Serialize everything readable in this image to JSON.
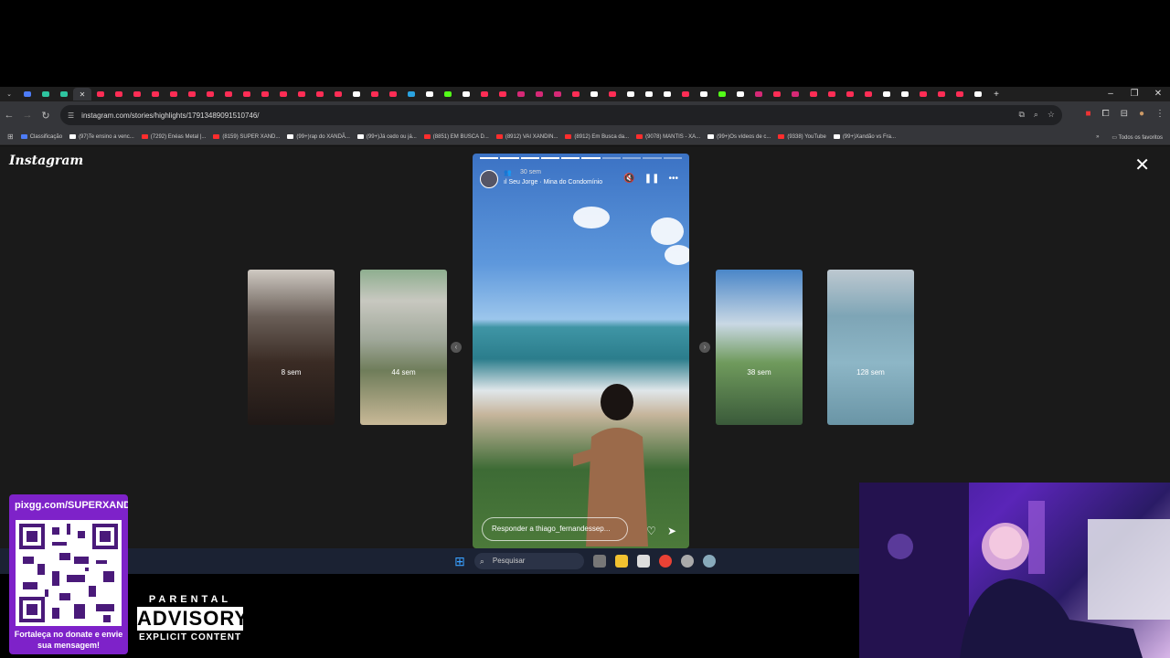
{
  "browser": {
    "url": "instagram.com/stories/highlights/17913489091510746/",
    "bookmarks": [
      {
        "label": "Classificação",
        "color": "#4d7cf7"
      },
      {
        "label": "(97)Te ensino a venc...",
        "color": "#ffffff"
      },
      {
        "label": "(7292) Enéas Metal |...",
        "color": "#ff2d2d"
      },
      {
        "label": "(8159) SUPER XAND...",
        "color": "#ff2d2d"
      },
      {
        "label": "(99+)rap do XANDÃ...",
        "color": "#ffffff"
      },
      {
        "label": "(99+)Já cedo ou já...",
        "color": "#ffffff"
      },
      {
        "label": "(8851) EM BUSCA D...",
        "color": "#ff2d2d"
      },
      {
        "label": "(8912) VAI XANDIN...",
        "color": "#ff2d2d"
      },
      {
        "label": "(8912) Em Busca da...",
        "color": "#ff2d2d"
      },
      {
        "label": "(9078) MANTIS - XA...",
        "color": "#ff2d2d"
      },
      {
        "label": "(99+)Os vídeos de c...",
        "color": "#ffffff"
      },
      {
        "label": "(9338) YouTube",
        "color": "#ff2d2d"
      },
      {
        "label": "(99+)Xandão vs Fra...",
        "color": "#ffffff"
      }
    ],
    "all_bookmarks": "Todos os favoritos",
    "window_controls": [
      "–",
      "❐",
      "✕"
    ]
  },
  "instagram": {
    "logo": "Instagram",
    "thumbs_left": [
      {
        "label": "8 sem"
      },
      {
        "label": "44 sem"
      }
    ],
    "thumbs_right": [
      {
        "label": "38 sem"
      },
      {
        "label": "128 sem"
      }
    ],
    "story": {
      "time": "30 sem",
      "music": "Seu Jorge · Mina do Condomínio",
      "reply_placeholder": "Responder a thiago_fernandessep...",
      "segments_total": 10,
      "segments_done": 6
    }
  },
  "taskbar": {
    "search_label": "Pesquisar"
  },
  "overlay": {
    "pix_url": "pixgg.com/SUPERXANDA",
    "pix_message": "Fortaleça no donate e envie sua mensagem!",
    "advisory_top": "PARENTAL",
    "advisory_mid": "ADVISORY",
    "advisory_bot": "EXPLICIT CONTENT"
  }
}
